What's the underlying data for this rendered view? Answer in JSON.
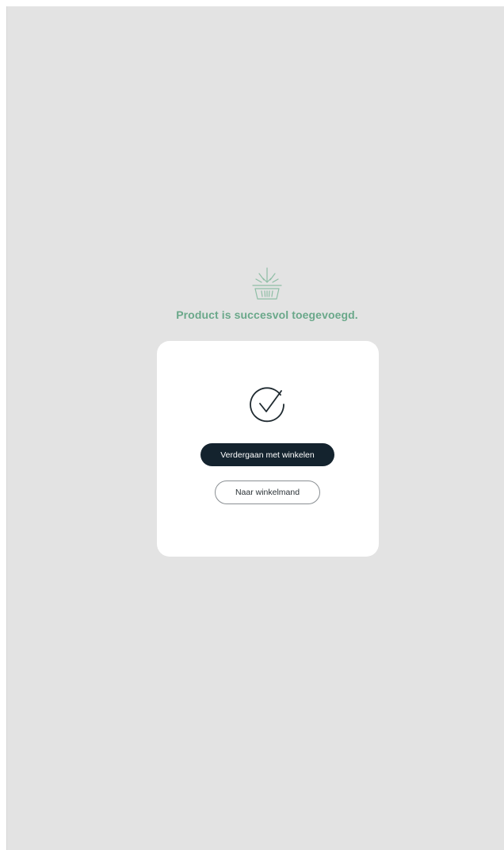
{
  "notification": {
    "icon": "basket-arrow-icon",
    "message": "Product is succesvol toegevoegd.",
    "accent_color": "#6aa88a"
  },
  "modal": {
    "icon": "check-circle-icon",
    "primary_button_label": "Verdergaan met winkelen",
    "secondary_button_label": "Naar winkelmand",
    "primary_color": "#14232e"
  }
}
